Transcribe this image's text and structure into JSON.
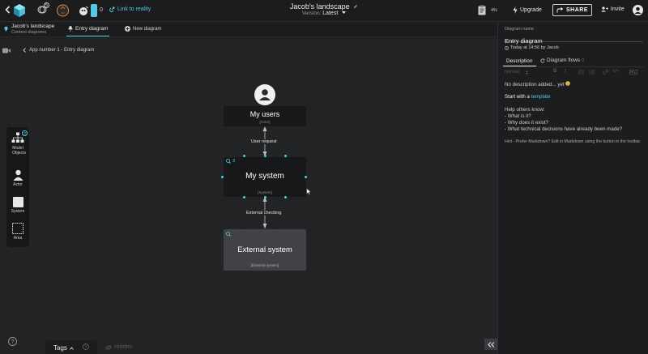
{
  "topbar": {
    "notifications_count": "5",
    "badge_count": "0",
    "link_label": "Link to reality",
    "landscape_title": "Jacob's landscape",
    "version_label": "Version:",
    "version_value": "Latest",
    "progress_percent": "4%",
    "upgrade_label": "Upgrade",
    "share_label": "SHARE",
    "invite_label": "Invite"
  },
  "subbar": {
    "landscape_name": "Jacob's landscape",
    "context_label": "Context diagrams",
    "active_tab": "Entry diagram",
    "new_tab": "New diagram"
  },
  "canvas": {
    "breadcrumb": "App number 1 - Entry diagram",
    "nodes": {
      "users": {
        "title": "My users",
        "subtitle": "[Actor]"
      },
      "system": {
        "title": "My system",
        "subtitle": "[System]",
        "count": "3"
      },
      "external": {
        "title": "External system",
        "subtitle": "[External system]"
      }
    },
    "connections": {
      "request": "User request",
      "checking": "External checking"
    }
  },
  "toolbox": {
    "model_objects_count": "3",
    "model_objects_label": "Model Objects",
    "actor_label": "Actor",
    "system_label": "System",
    "area_label": "Area"
  },
  "bottom": {
    "tags_label": "Tags",
    "hidden_label": "Hidden"
  },
  "panel": {
    "diagram_name_label": "Diagram name",
    "diagram_name_value": "Entry diagram",
    "updated_text": "Today at 14:56 by Jacob",
    "tab_description": "Description",
    "tab_flows": "Diagram flows",
    "tab_flows_count": "0",
    "format_normal": "Normal",
    "no_description": "No description added... yet",
    "start_prefix": "Start with a",
    "start_link": "template",
    "help_title": "Help others know:",
    "help_items": [
      "- What is it?",
      "- Why does it exist?",
      "- What technical decisions have already been made?"
    ],
    "hint": "Hint - Prefer Markdown? Edit in Markdown using the button in the toolbar."
  },
  "colors": {
    "accent": "#3fd6e8",
    "link": "#56c8e4",
    "background": "#222325"
  }
}
